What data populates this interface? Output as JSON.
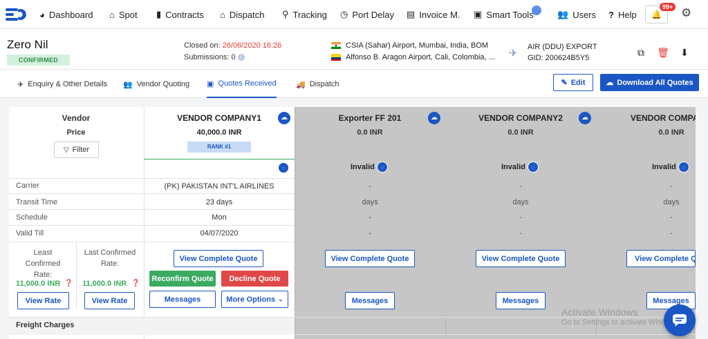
{
  "nav": {
    "items": [
      {
        "label": "Dashboard",
        "icon": "pie-chart-icon"
      },
      {
        "label": "Spot",
        "icon": "home-icon"
      },
      {
        "label": "Contracts",
        "icon": "bar-chart-icon"
      },
      {
        "label": "Dispatch",
        "icon": "warehouse-icon"
      },
      {
        "label": "Tracking",
        "icon": "map-pin-icon"
      },
      {
        "label": "Port Delay",
        "icon": "clock-icon"
      },
      {
        "label": "Invoice M.",
        "icon": "document-icon"
      },
      {
        "label": "Smart Tools",
        "icon": "toolbox-icon"
      },
      {
        "label": "Users",
        "icon": "users-icon"
      },
      {
        "label": "Help",
        "icon": "question-icon"
      }
    ],
    "notification_count": "99+"
  },
  "header": {
    "title": "Zero Nil",
    "status": "CONFIRMED",
    "closed_label": "Closed on: ",
    "closed_date": "26/06/2020 16:26",
    "submissions": "Submissions: 0",
    "origin": "CSIA (Sahar) Airport, Mumbai, India, BOM",
    "destination": "Alfonso B. Aragon Airport, Cali, Colombia, ...",
    "mode": "AIR (DDU) EXPORT",
    "gid": "GID: 200624B5Y5"
  },
  "tabs": [
    {
      "label": "Enquiry & Other Details",
      "icon": "plane-icon"
    },
    {
      "label": "Vendor Quoting",
      "icon": "users-icon"
    },
    {
      "label": "Quotes Received",
      "icon": "quote-icon"
    },
    {
      "label": "Dispatch",
      "icon": "truck-icon"
    }
  ],
  "actions": {
    "edit": "Edit",
    "download_all": "Download All Quotes"
  },
  "grid": {
    "vendor_header": "Vendor",
    "price_header": "Price",
    "filter": "Filter",
    "row_labels": {
      "carrier": "Carrier",
      "transit": "Transit Time",
      "schedule": "Schedule",
      "valid": "Valid Till"
    },
    "least_confirmed": "Least Confirmed Rate:",
    "last_confirmed": "Last Confirmed Rate:",
    "least_value": "11,000.0 INR",
    "last_value": "11,000.0 INR",
    "view_rate": "View Rate",
    "freight_charges": "Freight Charges",
    "vendors": [
      {
        "name": "VENDOR COMPANY1",
        "price": "40,000.0 INR",
        "rank": "RANK #1",
        "carrier": "(PK) PAKISTAN INT'L AIRLINES",
        "transit": "23 days",
        "schedule": "Mon",
        "valid": "04/07/2020",
        "status": ""
      },
      {
        "name": "Exporter FF 201",
        "price": "0.0 INR",
        "rank": "",
        "carrier": "-",
        "transit": "days",
        "schedule": "-",
        "valid": "-",
        "status": "Invalid"
      },
      {
        "name": "VENDOR COMPANY2",
        "price": "0.0 INR",
        "rank": "",
        "carrier": "-",
        "transit": "days",
        "schedule": "-",
        "valid": "-",
        "status": "Invalid"
      },
      {
        "name": "VENDOR COMPA",
        "price": "0.0 INR",
        "rank": "",
        "carrier": "-",
        "transit": "days",
        "schedule": "-",
        "valid": "-",
        "status": "Invalid"
      }
    ],
    "view_complete": "View Complete Quote",
    "view_complete_cut": "View Complete Q",
    "reconfirm": "Reconfirm Quote",
    "decline": "Decline Quote",
    "messages": "Messages",
    "more_options": "More Options"
  },
  "watermark": {
    "line1": "Activate Windows",
    "line2": "Go to Settings to activate Windows."
  },
  "colors": {
    "primary": "#1a56c4",
    "success": "#3caa60",
    "danger": "#e04848",
    "invalid_bg": "#c6c6c6"
  }
}
